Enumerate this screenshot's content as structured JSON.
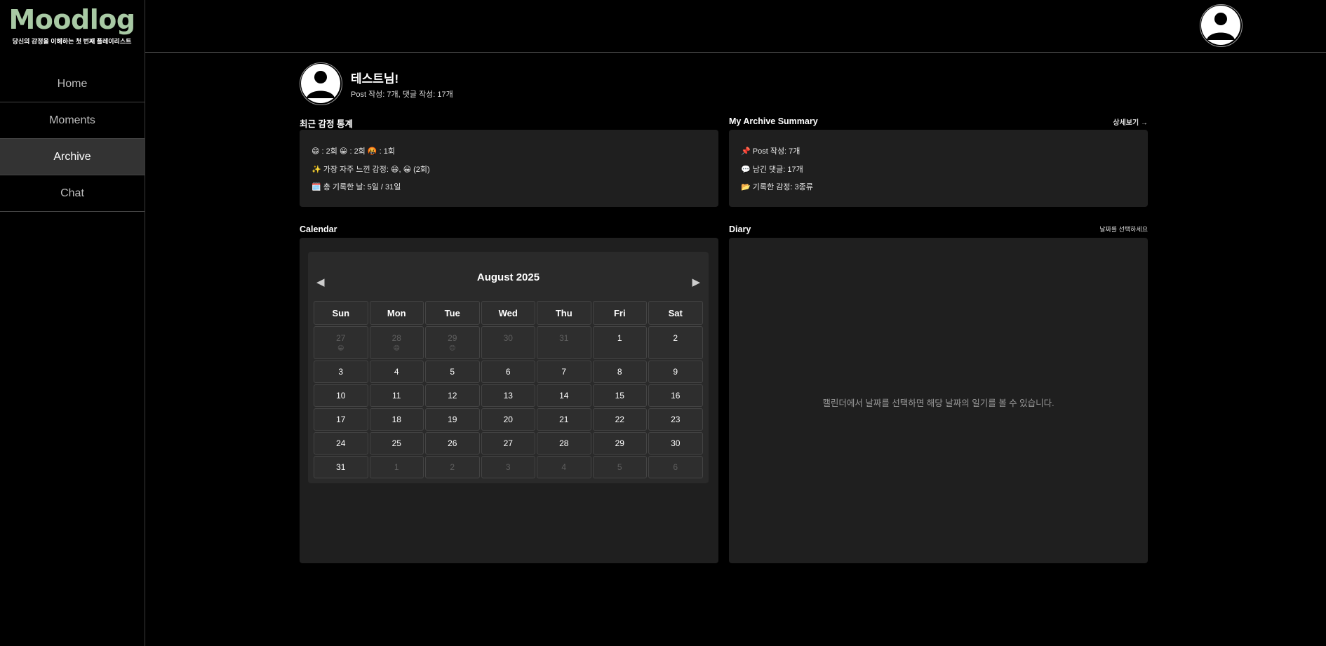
{
  "sidebar": {
    "logo": "Moodlog",
    "tagline": "당신의 감정을 이해하는 첫 번째 플레이리스트",
    "nav": [
      {
        "label": "Home"
      },
      {
        "label": "Moments"
      },
      {
        "label": "Archive",
        "active": true
      },
      {
        "label": "Chat"
      }
    ]
  },
  "header": {
    "avatar_icon": "user-avatar-icon"
  },
  "profile": {
    "name": "테스트님!",
    "stats": "Post 작성: 7개, 댓글 작성: 17개"
  },
  "stats_card": {
    "title": "최근 감정 통계",
    "line1": "😄 : 2회 😀 : 2회 🤬 : 1회",
    "line2": "✨ 가장 자주 느낀 감정: 😄, 😀 (2회)",
    "line3": "🗓️ 총 기록한 날: 5일 / 31일"
  },
  "summary_card": {
    "title": "My Archive Summary",
    "link": "상세보기 →",
    "line1": "📌 Post 작성: 7개",
    "line2": "💬 남긴 댓글: 17개",
    "line3": "📂 기록한 감정: 3종류"
  },
  "calendar": {
    "section_title": "Calendar",
    "month_label": "August 2025",
    "prev": "◀",
    "next": "▶",
    "weekdays": [
      "Sun",
      "Mon",
      "Tue",
      "Wed",
      "Thu",
      "Fri",
      "Sat"
    ],
    "weeks": [
      [
        {
          "d": "27",
          "m": true,
          "e": "😀"
        },
        {
          "d": "28",
          "m": true,
          "e": "😄"
        },
        {
          "d": "29",
          "m": true,
          "e": "😊"
        },
        {
          "d": "30",
          "m": true
        },
        {
          "d": "31",
          "m": true
        },
        {
          "d": "1"
        },
        {
          "d": "2"
        }
      ],
      [
        {
          "d": "3"
        },
        {
          "d": "4"
        },
        {
          "d": "5"
        },
        {
          "d": "6"
        },
        {
          "d": "7"
        },
        {
          "d": "8"
        },
        {
          "d": "9"
        }
      ],
      [
        {
          "d": "10"
        },
        {
          "d": "11"
        },
        {
          "d": "12"
        },
        {
          "d": "13"
        },
        {
          "d": "14"
        },
        {
          "d": "15"
        },
        {
          "d": "16"
        }
      ],
      [
        {
          "d": "17"
        },
        {
          "d": "18"
        },
        {
          "d": "19"
        },
        {
          "d": "20"
        },
        {
          "d": "21"
        },
        {
          "d": "22"
        },
        {
          "d": "23"
        }
      ],
      [
        {
          "d": "24"
        },
        {
          "d": "25"
        },
        {
          "d": "26"
        },
        {
          "d": "27"
        },
        {
          "d": "28"
        },
        {
          "d": "29"
        },
        {
          "d": "30"
        }
      ],
      [
        {
          "d": "31"
        },
        {
          "d": "1",
          "m": true
        },
        {
          "d": "2",
          "m": true
        },
        {
          "d": "3",
          "m": true
        },
        {
          "d": "4",
          "m": true
        },
        {
          "d": "5",
          "m": true
        },
        {
          "d": "6",
          "m": true
        }
      ]
    ]
  },
  "diary": {
    "title": "Diary",
    "hint": "날짜를 선택하세요",
    "empty_message": "캘린더에서 날짜를 선택하면 해당 날짜의 일기를 볼 수 있습니다."
  }
}
